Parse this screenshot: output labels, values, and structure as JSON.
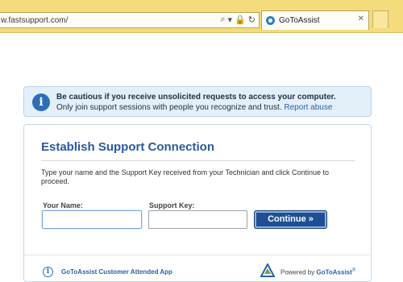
{
  "browser": {
    "address": "w.fastsupport.com/",
    "tab_title": "GoToAssist",
    "tab_close": "✕"
  },
  "caution": {
    "icon": "info-icon",
    "title": "Be cautious if you receive unsolicited requests to access your computer.",
    "message": "Only join support sessions with people you recognize and trust.",
    "link": "Report abuse"
  },
  "panel": {
    "title": "Establish Support Connection",
    "instructions": "Type your name and the Support Key received from your Technician and click Continue to proceed.",
    "name_label": "Your Name:",
    "name_value": "",
    "key_label": "Support Key:",
    "key_value": "",
    "continue_label": "Continue »"
  },
  "footer": {
    "app_label": "GoToAssist Customer Attended App",
    "powered_by": "Powered by",
    "brand": "GoToAssist",
    "registered": "®"
  },
  "colors": {
    "chrome": "#f4dc7c",
    "accent": "#2a5aa0",
    "button": "#1f4f93",
    "caution_bg": "#e3f0fa"
  }
}
